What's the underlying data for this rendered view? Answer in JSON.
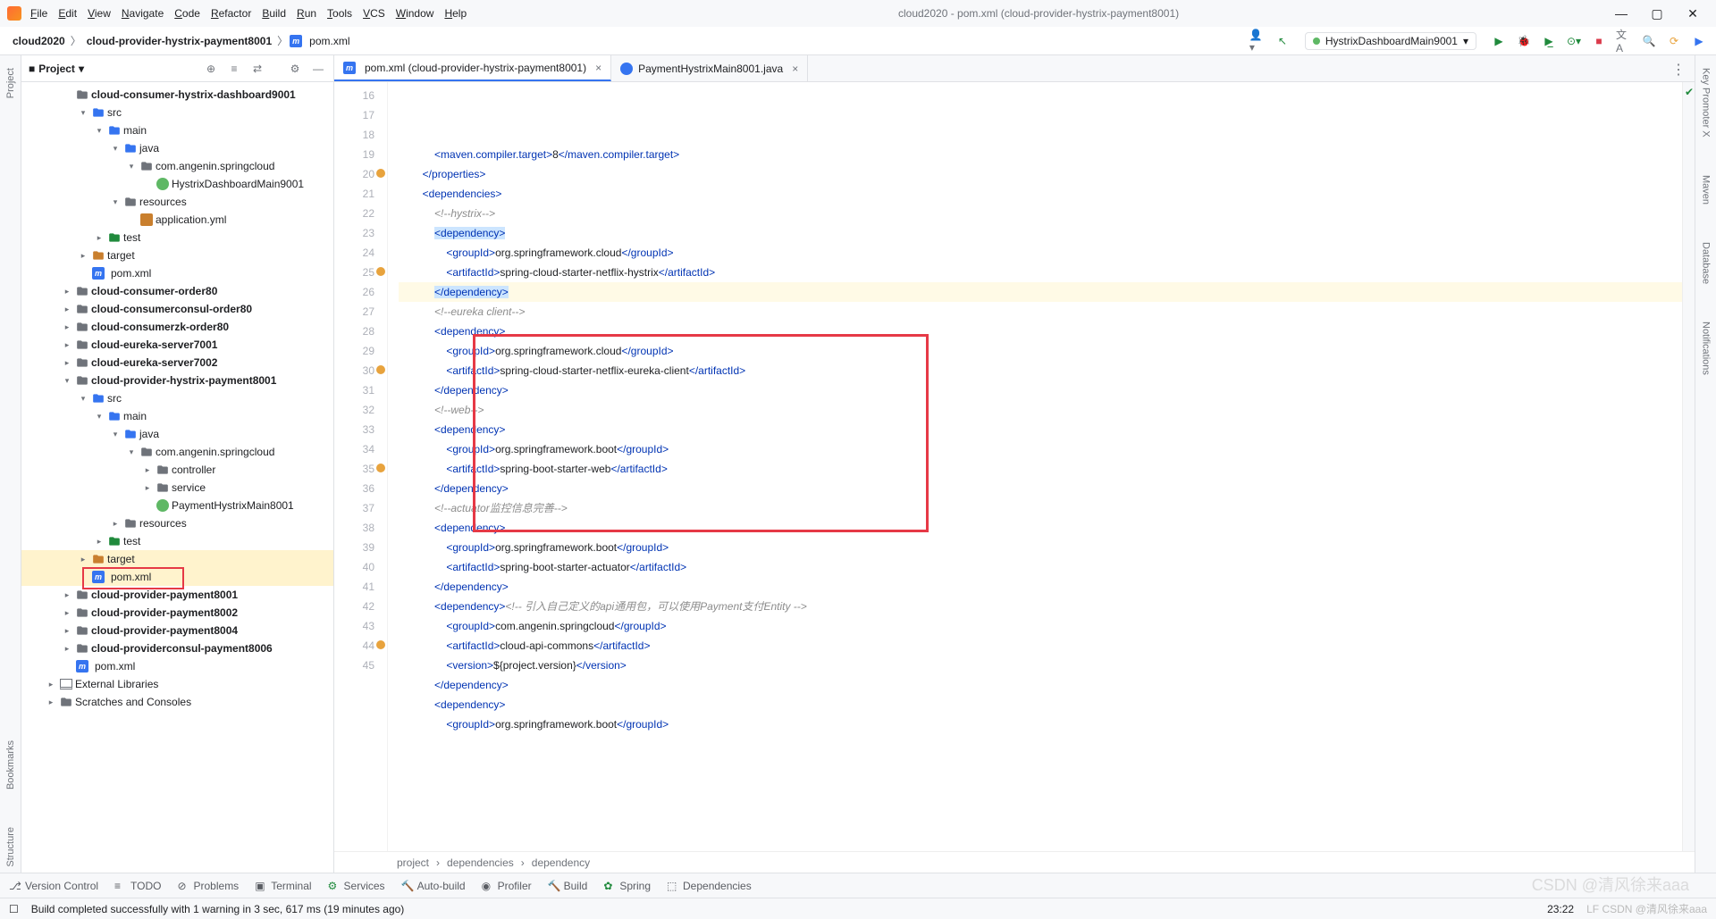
{
  "window": {
    "title": "cloud2020 - pom.xml (cloud-provider-hystrix-payment8001)"
  },
  "menu": [
    "File",
    "Edit",
    "View",
    "Navigate",
    "Code",
    "Refactor",
    "Build",
    "Run",
    "Tools",
    "VCS",
    "Window",
    "Help"
  ],
  "crumbs": {
    "project": "cloud2020",
    "module": "cloud-provider-hystrix-payment8001",
    "file": "pom.xml"
  },
  "runconfig": "HystrixDashboardMain9001",
  "projectPanel": {
    "title": "Project"
  },
  "tree": [
    {
      "indent": 2,
      "arrow": "",
      "icon": "folder",
      "label": "cloud-consumer-hystrix-dashboard9001",
      "bold": true,
      "cut": true
    },
    {
      "indent": 3,
      "arrow": "▾",
      "icon": "folder b",
      "label": "src"
    },
    {
      "indent": 4,
      "arrow": "▾",
      "icon": "folder b",
      "label": "main"
    },
    {
      "indent": 5,
      "arrow": "▾",
      "icon": "folder b",
      "label": "java"
    },
    {
      "indent": 6,
      "arrow": "▾",
      "icon": "folder",
      "label": "com.angenin.springcloud"
    },
    {
      "indent": 7,
      "arrow": "",
      "icon": "cls",
      "label": "HystrixDashboardMain9001"
    },
    {
      "indent": 5,
      "arrow": "▾",
      "icon": "folder",
      "label": "resources"
    },
    {
      "indent": 6,
      "arrow": "",
      "icon": "yml",
      "label": "application.yml"
    },
    {
      "indent": 4,
      "arrow": "▸",
      "icon": "folder t",
      "label": "test"
    },
    {
      "indent": 3,
      "arrow": "▸",
      "icon": "folder o",
      "label": "target"
    },
    {
      "indent": 3,
      "arrow": "",
      "icon": "m",
      "label": "pom.xml"
    },
    {
      "indent": 2,
      "arrow": "▸",
      "icon": "folder",
      "label": "cloud-consumer-order80",
      "bold": true
    },
    {
      "indent": 2,
      "arrow": "▸",
      "icon": "folder",
      "label": "cloud-consumerconsul-order80",
      "bold": true
    },
    {
      "indent": 2,
      "arrow": "▸",
      "icon": "folder",
      "label": "cloud-consumerzk-order80",
      "bold": true
    },
    {
      "indent": 2,
      "arrow": "▸",
      "icon": "folder",
      "label": "cloud-eureka-server7001",
      "bold": true
    },
    {
      "indent": 2,
      "arrow": "▸",
      "icon": "folder",
      "label": "cloud-eureka-server7002",
      "bold": true
    },
    {
      "indent": 2,
      "arrow": "▾",
      "icon": "folder",
      "label": "cloud-provider-hystrix-payment8001",
      "bold": true
    },
    {
      "indent": 3,
      "arrow": "▾",
      "icon": "folder b",
      "label": "src"
    },
    {
      "indent": 4,
      "arrow": "▾",
      "icon": "folder b",
      "label": "main"
    },
    {
      "indent": 5,
      "arrow": "▾",
      "icon": "folder b",
      "label": "java"
    },
    {
      "indent": 6,
      "arrow": "▾",
      "icon": "folder",
      "label": "com.angenin.springcloud"
    },
    {
      "indent": 7,
      "arrow": "▸",
      "icon": "folder",
      "label": "controller"
    },
    {
      "indent": 7,
      "arrow": "▸",
      "icon": "folder",
      "label": "service"
    },
    {
      "indent": 7,
      "arrow": "",
      "icon": "cls",
      "label": "PaymentHystrixMain8001"
    },
    {
      "indent": 5,
      "arrow": "▸",
      "icon": "folder",
      "label": "resources"
    },
    {
      "indent": 4,
      "arrow": "▸",
      "icon": "folder t",
      "label": "test"
    },
    {
      "indent": 3,
      "arrow": "▸",
      "icon": "folder o",
      "label": "target",
      "sel": true
    },
    {
      "indent": 3,
      "arrow": "",
      "icon": "m",
      "label": "pom.xml",
      "sel": true,
      "rbox": true
    },
    {
      "indent": 2,
      "arrow": "▸",
      "icon": "folder",
      "label": "cloud-provider-payment8001",
      "bold": true
    },
    {
      "indent": 2,
      "arrow": "▸",
      "icon": "folder",
      "label": "cloud-provider-payment8002",
      "bold": true
    },
    {
      "indent": 2,
      "arrow": "▸",
      "icon": "folder",
      "label": "cloud-provider-payment8004",
      "bold": true
    },
    {
      "indent": 2,
      "arrow": "▸",
      "icon": "folder",
      "label": "cloud-providerconsul-payment8006",
      "bold": true
    },
    {
      "indent": 2,
      "arrow": "",
      "icon": "m",
      "label": "pom.xml"
    },
    {
      "indent": 1,
      "arrow": "▸",
      "icon": "lib",
      "label": "External Libraries"
    },
    {
      "indent": 1,
      "arrow": "▸",
      "icon": "folder",
      "label": "Scratches and Consoles"
    }
  ],
  "tabs": [
    {
      "icon": "m",
      "label": "pom.xml (cloud-provider-hystrix-payment8001)",
      "active": true
    },
    {
      "icon": "j",
      "label": "PaymentHystrixMain8001.java",
      "active": false
    }
  ],
  "code": {
    "start": 16,
    "lines": [
      {
        "n": 16,
        "html": "            <span class='t-tag'>&lt;maven.compiler.target&gt;</span>8<span class='t-tag'>&lt;/maven.compiler.target&gt;</span>"
      },
      {
        "n": 17,
        "html": "        <span class='t-tag'>&lt;/properties&gt;</span>"
      },
      {
        "n": 18,
        "html": "        <span class='t-tag'>&lt;dependencies&gt;</span>"
      },
      {
        "n": 19,
        "html": "            <span class='t-comment'>&lt;!--hystrix--&gt;</span>"
      },
      {
        "n": 20,
        "mark": "o",
        "html": "            <span class='t-hl'><span class='t-tag'>&lt;dependency&gt;</span></span>"
      },
      {
        "n": 21,
        "html": "                <span class='t-tag'>&lt;groupId&gt;</span>org.springframework.cloud<span class='t-tag'>&lt;/groupId&gt;</span>"
      },
      {
        "n": 22,
        "html": "                <span class='t-tag'>&lt;artifactId&gt;</span>spring-cloud-starter-netflix-hystrix<span class='t-tag'>&lt;/artifactId&gt;</span>"
      },
      {
        "n": 23,
        "hl": true,
        "bulb": true,
        "html": "            <span class='t-hl'><span class='t-tag'>&lt;/dependency&gt;</span></span>"
      },
      {
        "n": 24,
        "html": "            <span class='t-comment'>&lt;!--eureka client--&gt;</span>"
      },
      {
        "n": 25,
        "mark": "o",
        "html": "            <span class='t-tag'>&lt;dependency&gt;</span>"
      },
      {
        "n": 26,
        "html": "                <span class='t-tag'>&lt;groupId&gt;</span>org.springframework.cloud<span class='t-tag'>&lt;/groupId&gt;</span>"
      },
      {
        "n": 27,
        "html": "                <span class='t-tag'>&lt;artifactId&gt;</span>spring-cloud-starter-netflix-eureka-client<span class='t-tag'>&lt;/artifactId&gt;</span>"
      },
      {
        "n": 28,
        "html": "            <span class='t-tag'>&lt;/dependency&gt;</span>"
      },
      {
        "n": 29,
        "html": "            <span class='t-comment'>&lt;!--web--&gt;</span>"
      },
      {
        "n": 30,
        "mark": "o",
        "html": "            <span class='t-tag'>&lt;dependency&gt;</span>"
      },
      {
        "n": 31,
        "html": "                <span class='t-tag'>&lt;groupId&gt;</span>org.springframework.boot<span class='t-tag'>&lt;/groupId&gt;</span>"
      },
      {
        "n": 32,
        "html": "                <span class='t-tag'>&lt;artifactId&gt;</span>spring-boot-starter-web<span class='t-tag'>&lt;/artifactId&gt;</span>"
      },
      {
        "n": 33,
        "html": "            <span class='t-tag'>&lt;/dependency&gt;</span>"
      },
      {
        "n": 34,
        "html": "            <span class='t-comment'>&lt;!--actuator<span class='t-zh'>监控信息完善</span>--&gt;</span>"
      },
      {
        "n": 35,
        "mark": "o",
        "html": "            <span class='t-tag'>&lt;dependency&gt;</span>"
      },
      {
        "n": 36,
        "html": "                <span class='t-tag'>&lt;groupId&gt;</span>org.springframework.boot<span class='t-tag'>&lt;/groupId&gt;</span>"
      },
      {
        "n": 37,
        "html": "                <span class='t-tag'>&lt;artifactId&gt;</span>spring-boot-starter-actuator<span class='t-tag'>&lt;/artifactId&gt;</span>"
      },
      {
        "n": 38,
        "html": "            <span class='t-tag'>&lt;/dependency&gt;</span>"
      },
      {
        "n": 39,
        "html": "            <span class='t-tag'>&lt;dependency&gt;</span><span class='t-comment'>&lt;!-- 引入自己定义的api通用包，可以使用Payment支付Entity --&gt;</span>"
      },
      {
        "n": 40,
        "html": "                <span class='t-tag'>&lt;groupId&gt;</span>com.angenin.springcloud<span class='t-tag'>&lt;/groupId&gt;</span>"
      },
      {
        "n": 41,
        "html": "                <span class='t-tag'>&lt;artifactId&gt;</span>cloud-api-commons<span class='t-tag'>&lt;/artifactId&gt;</span>"
      },
      {
        "n": 42,
        "html": "                <span class='t-tag'>&lt;version&gt;</span>${project.version}<span class='t-tag'>&lt;/version&gt;</span>"
      },
      {
        "n": 43,
        "html": "            <span class='t-tag'>&lt;/dependency&gt;</span>"
      },
      {
        "n": 44,
        "mark": "o",
        "html": "            <span class='t-tag'>&lt;dependency&gt;</span>"
      },
      {
        "n": 45,
        "html": "                <span class='t-tag'>&lt;groupId&gt;</span>org.springframework.boot<span class='t-tag'>&lt;/groupId&gt;</span>"
      }
    ]
  },
  "breadbar": [
    "project",
    "dependencies",
    "dependency"
  ],
  "toolwin": [
    {
      "icon": "⎇",
      "label": "Version Control"
    },
    {
      "icon": "≡",
      "label": "TODO"
    },
    {
      "icon": "⊘",
      "label": "Problems"
    },
    {
      "icon": "▣",
      "label": "Terminal"
    },
    {
      "icon": "⚙",
      "label": "Services",
      "green": true
    },
    {
      "icon": "🔨",
      "label": "Auto-build"
    },
    {
      "icon": "◉",
      "label": "Profiler"
    },
    {
      "icon": "🔨",
      "label": "Build"
    },
    {
      "icon": "✿",
      "label": "Spring",
      "green": true
    },
    {
      "icon": "⬚",
      "label": "Dependencies"
    }
  ],
  "status": {
    "msg": "Build completed successfully with 1 warning in 3 sec, 617 ms (19 minutes ago)",
    "time": "23:22",
    "right": "LF CSDN @清风徐来aaa"
  },
  "rgutter": [
    "Key Promoter X",
    "Maven",
    "Database",
    "Notifications"
  ],
  "lgutter": [
    "Project",
    "Bookmarks",
    "Structure"
  ]
}
